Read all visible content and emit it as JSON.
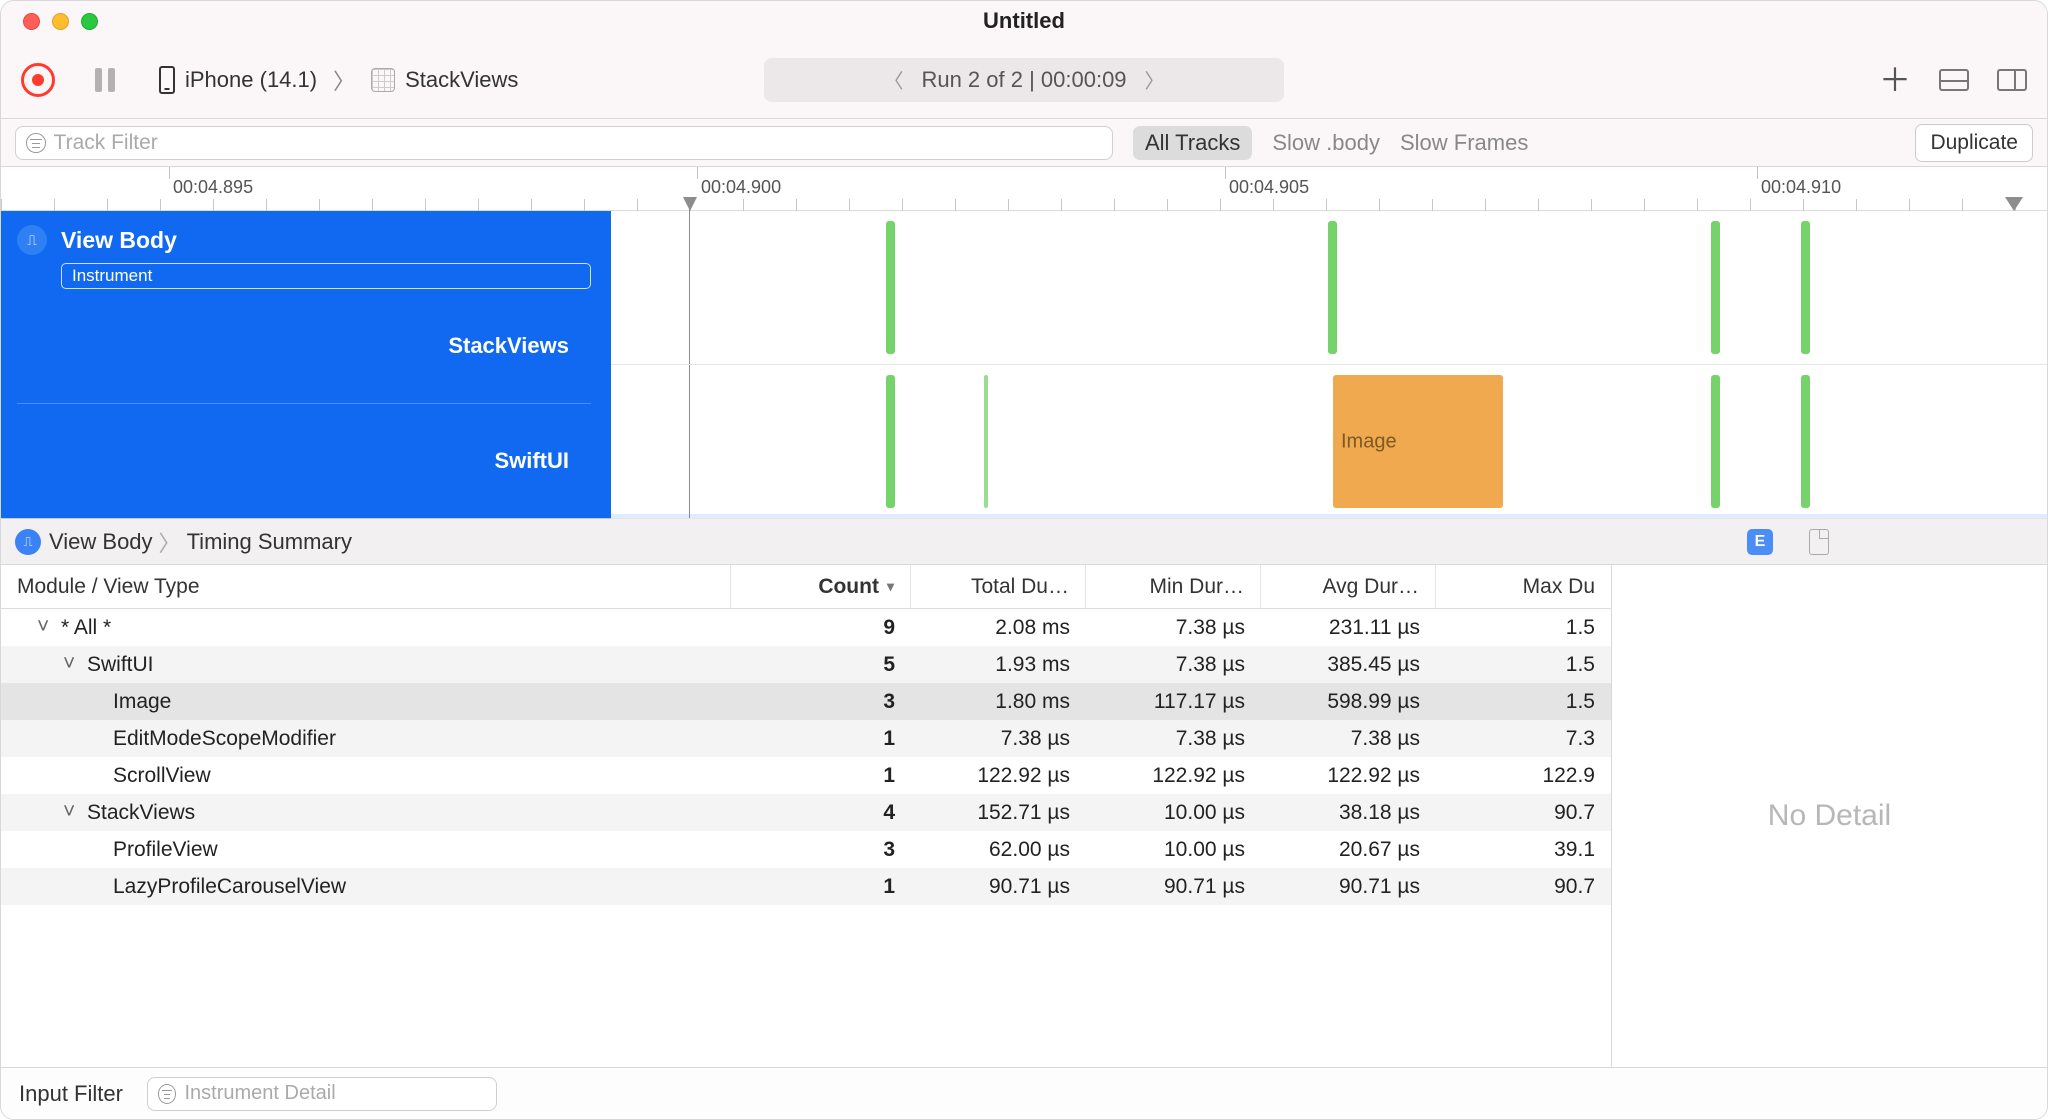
{
  "window": {
    "title": "Untitled"
  },
  "toolbar": {
    "device": "iPhone (14.1)",
    "target": "StackViews",
    "run_text": "Run 2 of 2  |  00:00:09"
  },
  "filterbar": {
    "track_placeholder": "Track Filter",
    "segments": {
      "all": "All Tracks",
      "body": "Slow .body",
      "frames": "Slow Frames"
    },
    "duplicate": "Duplicate"
  },
  "timeline": {
    "ticks": [
      "00:04.895",
      "00:04.900",
      "00:04.905",
      "00:04.910"
    ],
    "track": {
      "title": "View Body",
      "badge": "Instrument"
    },
    "lanes": {
      "a": "StackViews",
      "b": "SwiftUI"
    },
    "image_label": "Image"
  },
  "breadcrumb": {
    "a": "View Body",
    "b": "Timing Summary"
  },
  "table": {
    "headers": {
      "name": "Module / View Type",
      "count": "Count",
      "total": "Total Du…",
      "min": "Min Dur…",
      "avg": "Avg Dur…",
      "max": "Max Du"
    },
    "rows": [
      {
        "indent": 0,
        "disc": true,
        "sel": false,
        "name": "* All *",
        "count": "9",
        "total": "2.08 ms",
        "min": "7.38 µs",
        "avg": "231.11 µs",
        "max": "1.5"
      },
      {
        "indent": 1,
        "disc": true,
        "sel": false,
        "name": "SwiftUI",
        "count": "5",
        "total": "1.93 ms",
        "min": "7.38 µs",
        "avg": "385.45 µs",
        "max": "1.5"
      },
      {
        "indent": 2,
        "disc": false,
        "sel": true,
        "name": "Image",
        "count": "3",
        "total": "1.80 ms",
        "min": "117.17 µs",
        "avg": "598.99 µs",
        "max": "1.5"
      },
      {
        "indent": 2,
        "disc": false,
        "sel": false,
        "name": "EditModeScopeModifier",
        "count": "1",
        "total": "7.38 µs",
        "min": "7.38 µs",
        "avg": "7.38 µs",
        "max": "7.3"
      },
      {
        "indent": 2,
        "disc": false,
        "sel": false,
        "name": "ScrollView",
        "count": "1",
        "total": "122.92 µs",
        "min": "122.92 µs",
        "avg": "122.92 µs",
        "max": "122.9"
      },
      {
        "indent": 1,
        "disc": true,
        "sel": false,
        "name": "StackViews",
        "count": "4",
        "total": "152.71 µs",
        "min": "10.00 µs",
        "avg": "38.18 µs",
        "max": "90.7"
      },
      {
        "indent": 2,
        "disc": false,
        "sel": false,
        "name": "ProfileView",
        "count": "3",
        "total": "62.00 µs",
        "min": "10.00 µs",
        "avg": "20.67 µs",
        "max": "39.1"
      },
      {
        "indent": 2,
        "disc": false,
        "sel": false,
        "name": "LazyProfileCarouselView",
        "count": "1",
        "total": "90.71 µs",
        "min": "90.71 µs",
        "avg": "90.71 µs",
        "max": "90.7"
      }
    ]
  },
  "detail": {
    "empty": "No Detail"
  },
  "bottom": {
    "label": "Input Filter",
    "placeholder": "Instrument Detail"
  }
}
